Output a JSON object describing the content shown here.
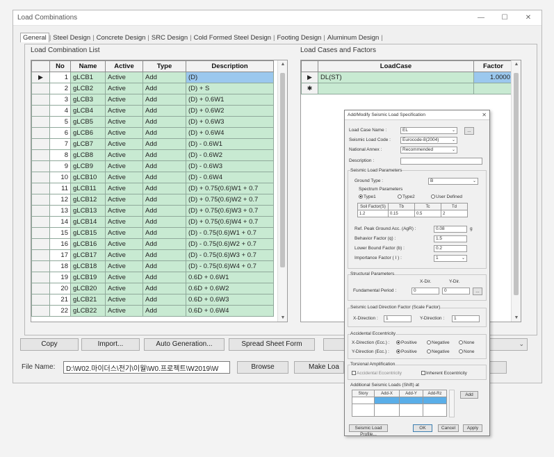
{
  "window": {
    "title": "Load Combinations",
    "minimize": "—",
    "maximize": "☐",
    "close": "✕"
  },
  "tabs": [
    "General",
    "Steel Design",
    "Concrete Design",
    "SRC Design",
    "Cold Formed Steel Design",
    "Footing Design",
    "Aluminum Design"
  ],
  "left_panel": {
    "label": "Load Combination List",
    "columns": [
      "",
      "No",
      "Name",
      "Active",
      "Type",
      "Description"
    ],
    "rows": [
      {
        "no": "1",
        "name": "gLCB1",
        "active": "Active",
        "type": "Add",
        "desc": "(D)"
      },
      {
        "no": "2",
        "name": "gLCB2",
        "active": "Active",
        "type": "Add",
        "desc": "(D) + S"
      },
      {
        "no": "3",
        "name": "gLCB3",
        "active": "Active",
        "type": "Add",
        "desc": "(D) + 0.6W1"
      },
      {
        "no": "4",
        "name": "gLCB4",
        "active": "Active",
        "type": "Add",
        "desc": "(D) + 0.6W2"
      },
      {
        "no": "5",
        "name": "gLCB5",
        "active": "Active",
        "type": "Add",
        "desc": "(D) + 0.6W3"
      },
      {
        "no": "6",
        "name": "gLCB6",
        "active": "Active",
        "type": "Add",
        "desc": "(D) + 0.6W4"
      },
      {
        "no": "7",
        "name": "gLCB7",
        "active": "Active",
        "type": "Add",
        "desc": "(D) - 0.6W1"
      },
      {
        "no": "8",
        "name": "gLCB8",
        "active": "Active",
        "type": "Add",
        "desc": "(D) - 0.6W2"
      },
      {
        "no": "9",
        "name": "gLCB9",
        "active": "Active",
        "type": "Add",
        "desc": "(D) - 0.6W3"
      },
      {
        "no": "10",
        "name": "gLCB10",
        "active": "Active",
        "type": "Add",
        "desc": "(D) - 0.6W4"
      },
      {
        "no": "11",
        "name": "gLCB11",
        "active": "Active",
        "type": "Add",
        "desc": "(D) + 0.75(0.6)W1 + 0.7"
      },
      {
        "no": "12",
        "name": "gLCB12",
        "active": "Active",
        "type": "Add",
        "desc": "(D) + 0.75(0.6)W2 + 0.7"
      },
      {
        "no": "13",
        "name": "gLCB13",
        "active": "Active",
        "type": "Add",
        "desc": "(D) + 0.75(0.6)W3 + 0.7"
      },
      {
        "no": "14",
        "name": "gLCB14",
        "active": "Active",
        "type": "Add",
        "desc": "(D) + 0.75(0.6)W4 + 0.7"
      },
      {
        "no": "15",
        "name": "gLCB15",
        "active": "Active",
        "type": "Add",
        "desc": "(D) - 0.75(0.6)W1 + 0.7"
      },
      {
        "no": "16",
        "name": "gLCB16",
        "active": "Active",
        "type": "Add",
        "desc": "(D) - 0.75(0.6)W2 + 0.7"
      },
      {
        "no": "17",
        "name": "gLCB17",
        "active": "Active",
        "type": "Add",
        "desc": "(D) - 0.75(0.6)W3 + 0.7"
      },
      {
        "no": "18",
        "name": "gLCB18",
        "active": "Active",
        "type": "Add",
        "desc": "(D) - 0.75(0.6)W4 + 0.7"
      },
      {
        "no": "19",
        "name": "gLCB19",
        "active": "Active",
        "type": "Add",
        "desc": "0.6D + 0.6W1"
      },
      {
        "no": "20",
        "name": "gLCB20",
        "active": "Active",
        "type": "Add",
        "desc": "0.6D + 0.6W2"
      },
      {
        "no": "21",
        "name": "gLCB21",
        "active": "Active",
        "type": "Add",
        "desc": "0.6D + 0.6W3"
      },
      {
        "no": "22",
        "name": "gLCB22",
        "active": "Active",
        "type": "Add",
        "desc": "0.6D + 0.6W4"
      }
    ]
  },
  "right_panel": {
    "label": "Load Cases and Factors",
    "columns": [
      "",
      "LoadCase",
      "Factor"
    ],
    "rows": [
      {
        "marker": "▶",
        "loadcase": "DL(ST)",
        "factor": "1.0000"
      },
      {
        "marker": "✱",
        "loadcase": "",
        "factor": ""
      }
    ]
  },
  "buttons": {
    "copy": "Copy",
    "import": "Import...",
    "auto_generation": "Auto Generation...",
    "spread_sheet": "Spread Sheet Form",
    "browse": "Browse",
    "make_load": "Make Loa"
  },
  "file_name": {
    "label": "File Name:",
    "value": "D:\\W02.마이더스\\전기\\이월\\W0.프로젝트\\W2019\\W"
  },
  "seismic_dialog": {
    "title": "Add/Modify Seismic Load Specification",
    "load_case_name_label": "Load Case Name :",
    "load_case_name": "EL",
    "load_case_more": "...",
    "seismic_code_label": "Seismic Load Code :",
    "seismic_code": "Eurocode-8(2004)",
    "national_annex_label": "National Annex :",
    "national_annex": "Recommended",
    "description_label": "Description :",
    "description": "",
    "seismic_params_label": "Seismic Load Parameters",
    "ground_type_label": "Ground Type :",
    "ground_type": "B",
    "spectrum_params_label": "Spectrum Parameters",
    "type1": "Type1",
    "type2": "Type2",
    "user_defined": "User Defined",
    "spec_headers": [
      "Soil Factor(S)",
      "Tb",
      "Tc",
      "Td"
    ],
    "spec_values": [
      "1.2",
      "0.15",
      "0.5",
      "2"
    ],
    "ref_pga_label": "Ref. Peak Ground Acc. (AgR) :",
    "ref_pga": "0.08",
    "ref_pga_unit": "g",
    "behavior_factor_label": "Behavior Factor (q) :",
    "behavior_factor": "1.5",
    "lower_bound_label": "Lower Bound Factor (b) :",
    "lower_bound": "0.2",
    "importance_label": "Importance Factor ( I ) :",
    "importance": "1",
    "structural_params_label": "Structural Parameters",
    "x_dir": "X-Dir.",
    "y_dir": "Y-Dir.",
    "fund_period_label": "Fundamental Period :",
    "fund_period_x": "0",
    "fund_period_y": "0",
    "direction_factor_label": "Seismic Load Direction Factor (Scale Factor)",
    "x_direction_label": "X-Direction :",
    "x_direction": "1",
    "y_direction_label": "Y-Direction :",
    "y_direction": "1",
    "acc_ecc_label": "Accidental Eccentricity",
    "x_ecc_label": "X-Direction (Ecc.) :",
    "y_ecc_label": "Y-Direction (Ecc.) :",
    "positive": "Positive",
    "negative": "Negative",
    "none": "None",
    "torsional_label": "Torsional Amplification",
    "accidental_ecc": "Accidental Eccentricity",
    "inherent_ecc": "Inherent Eccentricity",
    "additional_label": "Additional Seismic Loads (Shift) at",
    "add_cols": [
      "Story",
      "Add-X",
      "Add-Y",
      "Add-Rz"
    ],
    "add_button": "Add",
    "seismic_profile": "Seismic Load Profile...",
    "ok": "OK",
    "cancel": "Cancel",
    "apply": "Apply"
  }
}
